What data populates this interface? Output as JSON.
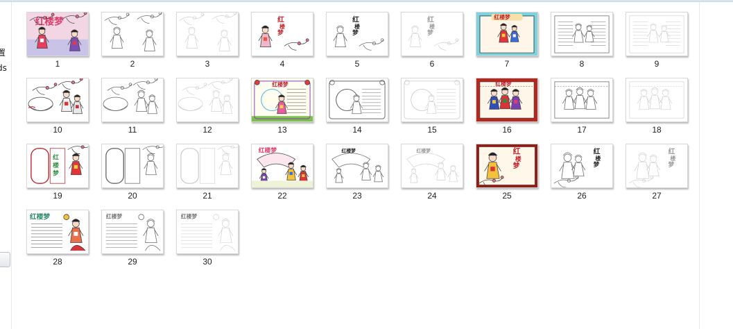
{
  "nav": {
    "labels": [
      "置",
      "ds"
    ]
  },
  "files": [
    {
      "label": "1",
      "icon": "color-cover-thumbnail"
    },
    {
      "label": "2",
      "icon": "line-drawing-thumbnail"
    },
    {
      "label": "3",
      "icon": "faint-line-drawing-thumbnail"
    },
    {
      "label": "4",
      "icon": "calligraphy-color-thumbnail"
    },
    {
      "label": "5",
      "icon": "calligraphy-line-thumbnail"
    },
    {
      "label": "6",
      "icon": "faint-calligraphy-thumbnail"
    },
    {
      "label": "7",
      "icon": "color-poster-thumbnail"
    },
    {
      "label": "8",
      "icon": "line-poster-thumbnail"
    },
    {
      "label": "9",
      "icon": "faint-poster-thumbnail"
    },
    {
      "label": "10",
      "icon": "color-scene-thumbnail"
    },
    {
      "label": "11",
      "icon": "line-scene-thumbnail"
    },
    {
      "label": "12",
      "icon": "faint-scene-thumbnail"
    },
    {
      "label": "13",
      "icon": "color-lantern-thumbnail"
    },
    {
      "label": "14",
      "icon": "line-lantern-thumbnail"
    },
    {
      "label": "15",
      "icon": "faint-lantern-thumbnail"
    },
    {
      "label": "16",
      "icon": "color-group-thumbnail"
    },
    {
      "label": "17",
      "icon": "line-group-thumbnail"
    },
    {
      "label": "18",
      "icon": "faint-group-thumbnail"
    },
    {
      "label": "19",
      "icon": "color-frame-thumbnail"
    },
    {
      "label": "20",
      "icon": "line-frame-thumbnail"
    },
    {
      "label": "21",
      "icon": "faint-frame-thumbnail"
    },
    {
      "label": "22",
      "icon": "color-fan-thumbnail"
    },
    {
      "label": "23",
      "icon": "line-fan-thumbnail"
    },
    {
      "label": "24",
      "icon": "faint-fan-thumbnail"
    },
    {
      "label": "25",
      "icon": "color-portrait-thumbnail"
    },
    {
      "label": "26",
      "icon": "line-portrait-thumbnail"
    },
    {
      "label": "27",
      "icon": "faint-portrait-thumbnail"
    },
    {
      "label": "28",
      "icon": "color-lined-thumbnail"
    },
    {
      "label": "29",
      "icon": "line-lined-thumbnail"
    },
    {
      "label": "30",
      "icon": "faint-lined-thumbnail"
    }
  ]
}
